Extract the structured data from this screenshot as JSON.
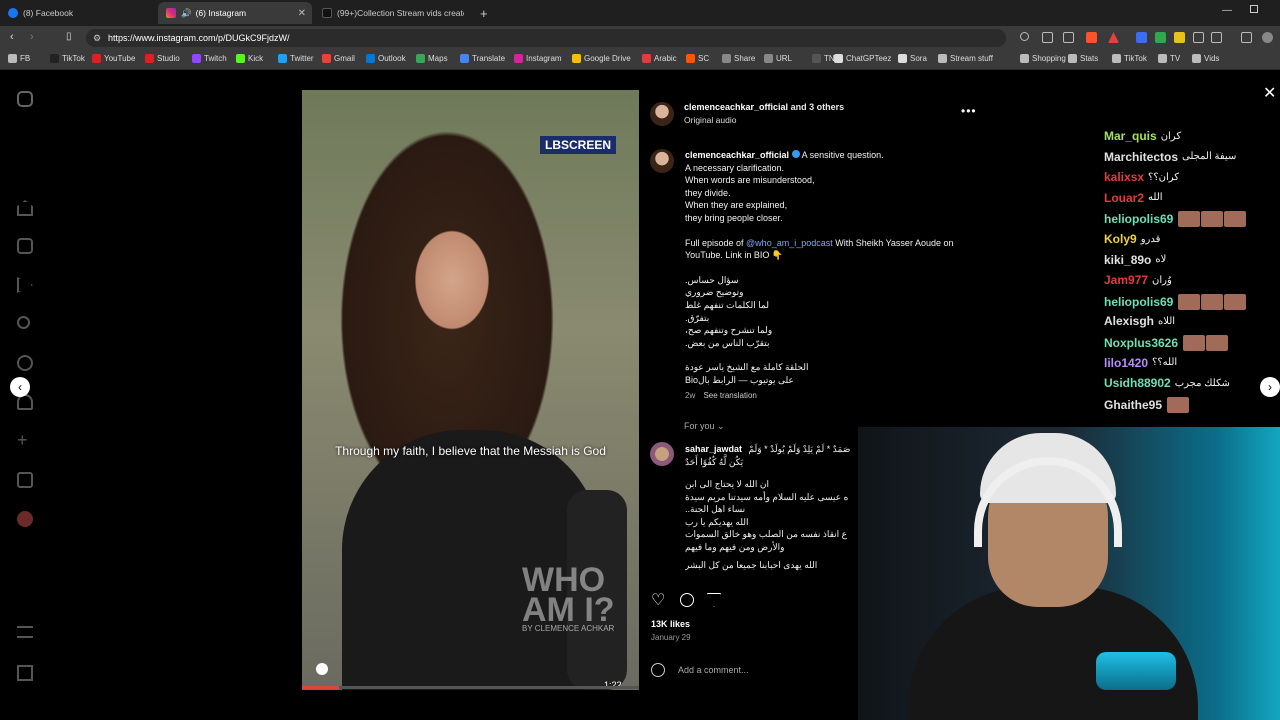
{
  "browser": {
    "tabs": [
      {
        "label": "(8) Facebook",
        "color": "#1877f2"
      },
      {
        "label": "(6) Instagram",
        "color": "#d6249f"
      },
      {
        "label": "(99+)Collection Stream vids created",
        "color": "#111111"
      }
    ],
    "new_tab": "+",
    "url": "https://www.instagram.com/p/DUGkC9FjdzW/",
    "bookmarks": [
      {
        "label": "FB",
        "icon": "folder-icon"
      },
      {
        "label": "TikTok",
        "icon": "tiktok-icon"
      },
      {
        "label": "YouTube",
        "icon": "youtube-icon"
      },
      {
        "label": "Studio",
        "icon": "youtube-icon"
      },
      {
        "label": "Twitch",
        "icon": "twitch-icon"
      },
      {
        "label": "Kick",
        "icon": "kick-icon"
      },
      {
        "label": "Twitter",
        "icon": "twitter-icon"
      },
      {
        "label": "Gmail",
        "icon": "gmail-icon"
      },
      {
        "label": "Outlook",
        "icon": "outlook-icon"
      },
      {
        "label": "Maps",
        "icon": "maps-icon"
      },
      {
        "label": "Translate",
        "icon": "translate-icon"
      },
      {
        "label": "Instagram",
        "icon": "instagram-icon"
      },
      {
        "label": "Google Drive",
        "icon": "drive-icon"
      },
      {
        "label": "Arabic",
        "icon": "arabic-icon"
      },
      {
        "label": "SC",
        "icon": "sc-icon"
      },
      {
        "label": "Share",
        "icon": "share-icon"
      },
      {
        "label": "URL",
        "icon": "url-icon"
      },
      {
        "label": "TN",
        "icon": "tn-icon"
      },
      {
        "label": "ChatGPTeez",
        "icon": "chatgpt-icon"
      },
      {
        "label": "Sora",
        "icon": "sora-icon"
      },
      {
        "label": "Stream stuff",
        "icon": "folder-icon"
      },
      {
        "label": "Shopping",
        "icon": "folder-icon"
      },
      {
        "label": "Stats",
        "icon": "folder-icon"
      },
      {
        "label": "TikTok",
        "icon": "folder-icon"
      },
      {
        "label": "TV",
        "icon": "folder-icon"
      },
      {
        "label": "Vids",
        "icon": "folder-icon"
      }
    ]
  },
  "video": {
    "watermark_top": "LBSCREEN",
    "subtitle": "Through my faith, I believe that the Messiah is God",
    "logo_text": "WHO AM I?",
    "logo_sub": "BY CLEMENCE ACHKAR",
    "duration": "1:22",
    "progress_fraction": 0.11
  },
  "post": {
    "header_user": "clemenceachkar_official",
    "header_others": "and 3 others",
    "audio": "Original audio",
    "more_icon": "more-icon",
    "caption_user": "clemenceachkar_official",
    "caption_en": [
      "A sensitive question.",
      "A necessary clarification.",
      "When words are misunderstood,",
      "they divide.",
      "When they are explained,",
      "they bring people closer."
    ],
    "episode_prefix": "Full episode of ",
    "episode_link": "@who_am_i_podcast",
    "episode_suffix": " With Sheikh Yasser Aoude on YouTube. Link in BIO 👇",
    "caption_ar": [
      "سؤال حساس.",
      "وتوضيح ضروري",
      "لما الكلمات تنفهم غلط",
      "بتفرّق.",
      "ولما تنشرح وتنفهم صح،",
      "بتقرّب الناس من بعض."
    ],
    "caption_ar2": [
      "الحلقة كاملة مع الشيخ ياسر عودة",
      "Bioعلى يوتيوب — الرابط بال"
    ],
    "age": "2w",
    "see_translation": "See translation",
    "for_you": "For you",
    "comment_user": "sahar_jawdat",
    "comment_lines": [
      "صَمَدٌ * لَمْ يَلِدْ وَلَمْ يُولَدْ * وَلَمْ",
      "يَكُن لَّهُ كُفُوًا أَحَدٌ",
      "ان الله لا يحتاج الى ابن",
      "ه عيسى عليه السلام وأمه سيدتنا مريم سيدة",
      "نساء اهل الجنة..",
      "الله يهديكم يا رب",
      "ع انقاذ نفسه من الصلب وهو خالق السموات",
      "والأرض ومن فيهم وما فيهم",
      "الله يهدى احبابنا جميعا من كل البشر"
    ],
    "likes": "13K likes",
    "date": "January 29",
    "add_comment": "Add a comment..."
  },
  "chat": [
    {
      "name": "Mar_quis",
      "color": "#a7e15a",
      "msg": "كران",
      "emotes": 0
    },
    {
      "name": "Marchitectos",
      "color": "#e0e0e0",
      "msg": "سيفة المجلى",
      "emotes": 0
    },
    {
      "name": "kalixsx",
      "color": "#e23c3c",
      "msg": "كران؟؟",
      "emotes": 0
    },
    {
      "name": "Louar2",
      "color": "#e23c3c",
      "msg": "الله",
      "emotes": 0
    },
    {
      "name": "heliopolis69",
      "color": "#6be0b8",
      "msg": "",
      "emotes": 3
    },
    {
      "name": "Koly9",
      "color": "#f0d23c",
      "msg": "قدرو",
      "emotes": 0
    },
    {
      "name": "kiki_89o",
      "color": "#e0e0e0",
      "msg": "لاه",
      "emotes": 0
    },
    {
      "name": "Jam977",
      "color": "#e23c3c",
      "msg": "وُران",
      "emotes": 0
    },
    {
      "name": "heliopolis69",
      "color": "#6be0b8",
      "msg": "",
      "emotes": 3
    },
    {
      "name": "Alexisgh",
      "color": "#e0e0e0",
      "msg": "اللاه",
      "emotes": 0
    },
    {
      "name": "Noxplus3626",
      "color": "#6be0b8",
      "msg": "",
      "emotes": 2
    },
    {
      "name": "lilo1420",
      "color": "#b98cff",
      "msg": "الله؟؟",
      "emotes": 0
    },
    {
      "name": "Usidh88902",
      "color": "#6be0b8",
      "msg": "شكلك مجرب",
      "emotes": 0
    },
    {
      "name": "Ghaithe95",
      "color": "#e0e0e0",
      "msg": "",
      "emotes": 1
    }
  ],
  "colors": {
    "accent_blue": "#7da7ff",
    "verified": "#3897f0",
    "progress": "#e0443c"
  }
}
